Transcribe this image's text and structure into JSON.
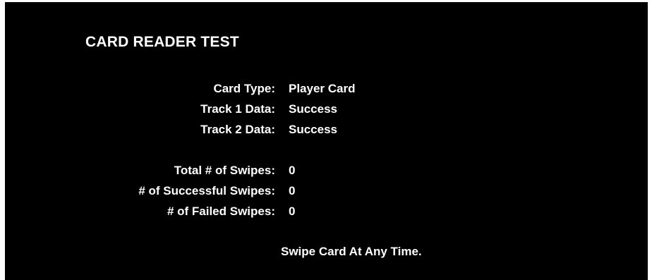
{
  "title": "CARD READER TEST",
  "card_info": {
    "card_type_label": "Card Type:",
    "card_type_value": "Player Card",
    "track1_label": "Track 1 Data:",
    "track1_value": "Success",
    "track2_label": "Track 2 Data:",
    "track2_value": "Success"
  },
  "stats": {
    "total_label": "Total # of Swipes:",
    "total_value": "0",
    "successful_label": "# of Successful Swipes:",
    "successful_value": "0",
    "failed_label": "# of Failed Swipes:",
    "failed_value": "0"
  },
  "message": "Swipe Card At Any Time.",
  "colors": {
    "background": "#000000",
    "text": "#ffffff"
  }
}
